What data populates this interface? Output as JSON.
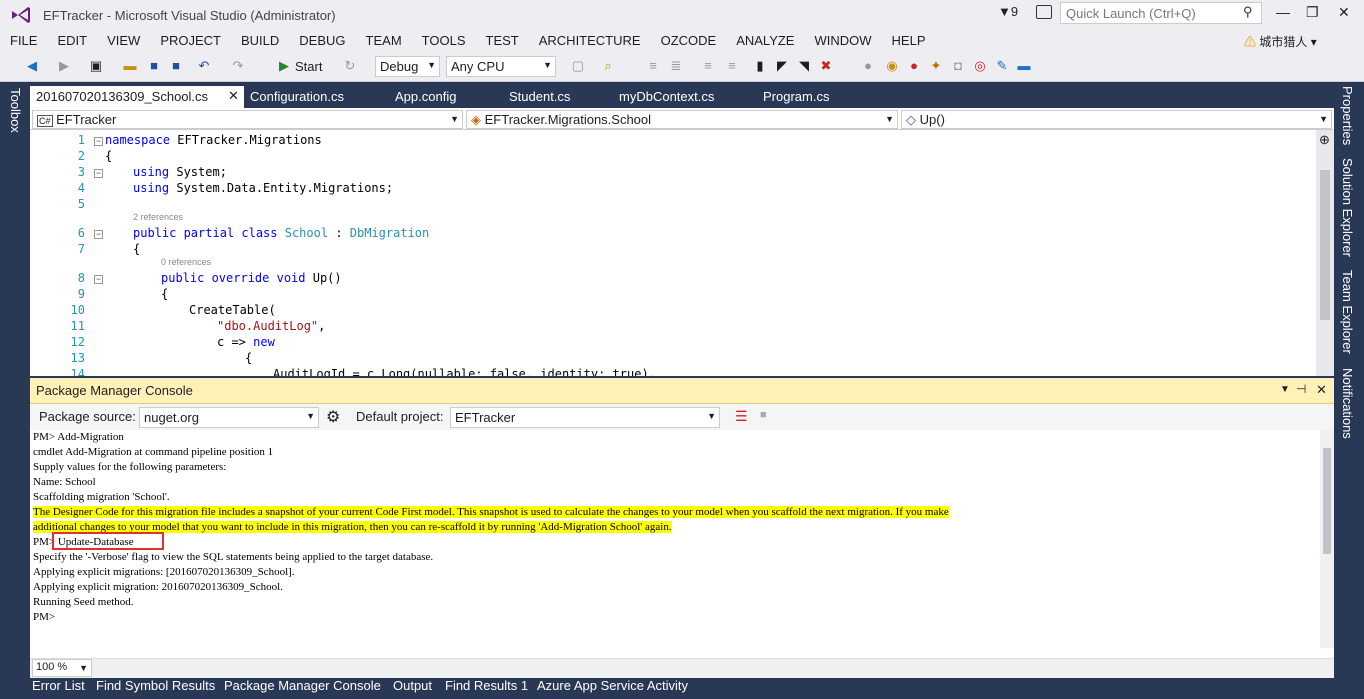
{
  "window": {
    "title": "EFTracker - Microsoft Visual Studio (Administrator)",
    "notification_count": "9",
    "quick_launch_placeholder": "Quick Launch (Ctrl+Q)",
    "user_name": "城市猎人"
  },
  "menu": [
    "FILE",
    "EDIT",
    "VIEW",
    "PROJECT",
    "BUILD",
    "DEBUG",
    "TEAM",
    "TOOLS",
    "TEST",
    "ARCHITECTURE",
    "OZCODE",
    "ANALYZE",
    "WINDOW",
    "HELP"
  ],
  "toolbar": {
    "start_label": "Start",
    "configuration": "Debug",
    "platform": "Any CPU"
  },
  "side_panels": {
    "left": "Toolbox",
    "right": [
      "Properties",
      "Solution Explorer",
      "Team Explorer",
      "Notifications"
    ]
  },
  "tabs": [
    "201607020136309_School.cs",
    "Configuration.cs",
    "App.config",
    "Student.cs",
    "myDbContext.cs",
    "Program.cs"
  ],
  "navbar": {
    "project": "EFTracker",
    "type": "EFTracker.Migrations.School",
    "member": "Up()"
  },
  "code": {
    "line_numbers": [
      "1",
      "2",
      "3",
      "4",
      "5",
      "6",
      "7",
      "8",
      "9",
      "10",
      "11",
      "12",
      "13",
      "14"
    ],
    "refs_class": "2 references",
    "refs_method": "0 references",
    "lines": {
      "l1_kw": "namespace",
      "l1_rest": " EFTracker.Migrations",
      "l2": "{",
      "l3_kw": "using",
      "l3_rest": " System;",
      "l4_kw": "using",
      "l4_rest": " System.Data.Entity.Migrations;",
      "l6_kw": "public partial class",
      "l6_type": "School",
      "l6_sep": " : ",
      "l6_base": "DbMigration",
      "l7": "{",
      "l8_kw": "public override void",
      "l8_rest": " Up()",
      "l9": "{",
      "l10": "CreateTable(",
      "l11_str": "\"dbo.AuditLog\"",
      "l11_rest": ",",
      "l12_a": "c => ",
      "l12_kw": "new",
      "l13": "{",
      "l14": "AuditLogId = c.Long(nullable: false, identity: true),"
    }
  },
  "package_manager": {
    "title": "Package Manager Console",
    "source_label": "Package source:",
    "source_value": "nuget.org",
    "project_label": "Default project:",
    "project_value": "EFTracker",
    "zoom": "100 %",
    "console_lines": [
      "PM> Add-Migration",
      "cmdlet Add-Migration at command pipeline position 1",
      "Supply values for the following parameters:",
      "Name: School",
      "Scaffolding migration 'School'.",
      "The Designer Code for this migration file includes a snapshot of your current Code First model. This snapshot is used to calculate the changes to your model when you scaffold the next migration. If you make",
      "additional changes to your model that you want to include in this migration, then you can re-scaffold it by running 'Add-Migration School' again.",
      "PM> Update-Database",
      "Specify the '-Verbose' flag to view the SQL statements being applied to the target database.",
      "Applying explicit migrations: [201607020136309_School].",
      "Applying explicit migration: 201607020136309_School.",
      "Running Seed method.",
      "PM>"
    ]
  },
  "bottom_tabs": [
    "Error List",
    "Find Symbol Results",
    "Package Manager Console",
    "Output",
    "Find Results 1",
    "Azure App Service Activity"
  ]
}
